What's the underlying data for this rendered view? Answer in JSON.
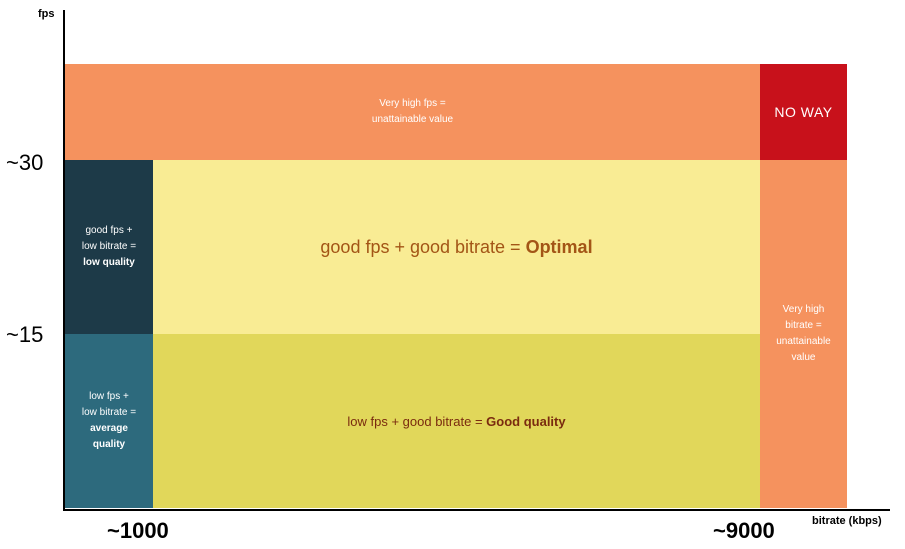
{
  "axes": {
    "y_title": "fps",
    "x_title": "bitrate (kbps)",
    "y_ticks": {
      "t30": "~30",
      "t15": "~15"
    },
    "x_ticks": {
      "t1000": "~1000",
      "t9000": "~9000"
    }
  },
  "regions": {
    "top": {
      "line1": "Very high fps =",
      "line2": "unattainable value"
    },
    "noway": {
      "label": "NO WAY"
    },
    "right": {
      "line1": "Very high",
      "line2": "bitrate =",
      "line3": "unattainable",
      "line4": "value"
    },
    "dark": {
      "line1": "good fps +",
      "line2": "low bitrate =",
      "line3": "low quality"
    },
    "teal": {
      "line1": "low fps +",
      "line2": "low bitrate =",
      "line3": "average",
      "line4": "quality"
    },
    "optimal": {
      "prefix": "good fps + good bitrate = ",
      "emph": "Optimal"
    },
    "good": {
      "prefix": "low fps + good bitrate = ",
      "emph": "Good quality"
    }
  },
  "colors": {
    "orange": "#f5925e",
    "red": "#c8111b",
    "dark_teal": "#1d3a48",
    "teal": "#2d6a7d",
    "light_yellow": "#f9ec94",
    "yellow": "#e1d75a"
  }
}
